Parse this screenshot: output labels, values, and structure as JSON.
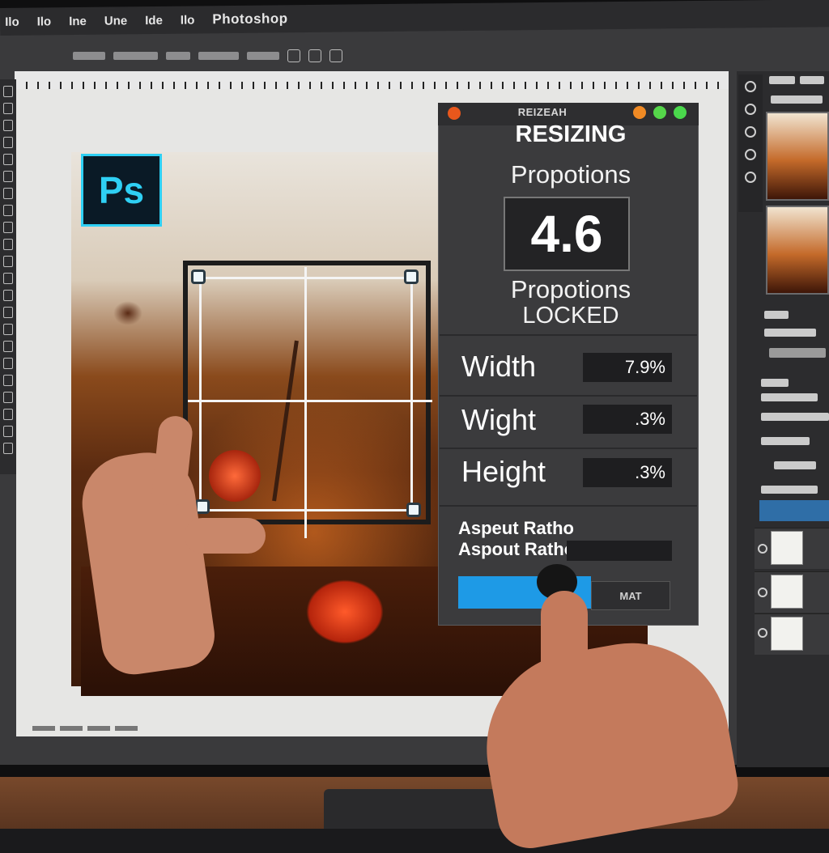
{
  "menubar": {
    "items": [
      "Ilo",
      "Ilo",
      "Ine",
      "Une",
      "Ide",
      "Ilo"
    ],
    "app_title": "Photoshop"
  },
  "logo": {
    "text": "Ps",
    "color": "#2fd0f4"
  },
  "dialog": {
    "small_title": "REIZEAH",
    "title": "RESIZING",
    "proportions_label": "Propotions",
    "ratio_value": "4.6",
    "locked_line1": "Propotions",
    "locked_line2": "LOCKED",
    "rows": [
      {
        "label": "Width",
        "value": "7.9%"
      },
      {
        "label": "Wight",
        "value": ".3%"
      },
      {
        "label": "Height",
        "value": ".3%"
      }
    ],
    "aspect_line1": "Aspeut Ratho",
    "aspect_line2": "Aspout Ratho",
    "secondary_button": "MAT",
    "accent_color": "#1e9ae6",
    "traffic_lights": [
      "#e8571c",
      "#f08a24",
      "#55d64a",
      "#4ad84c"
    ]
  },
  "icons": [
    "logo-icon",
    "close-icon",
    "minimize-icon",
    "maximize-icon",
    "eye-icon",
    "tool-icon"
  ]
}
